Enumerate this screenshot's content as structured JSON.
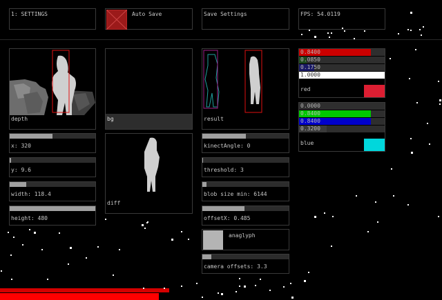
{
  "header": {
    "tab_label": "1: SETTINGS",
    "autosave_label": "Auto Save",
    "save_label": "Save Settings",
    "fps_label": "FPS: 54.0119"
  },
  "views": {
    "depth": "depth",
    "bg": "bg",
    "result": "result",
    "diff": "diff"
  },
  "sliders_left": [
    {
      "label": "x: 320",
      "value": 0.5
    },
    {
      "label": "y: 9.6",
      "value": 0.02
    },
    {
      "label": "width: 118.4",
      "value": 0.19
    },
    {
      "label": "height: 480",
      "value": 1.0
    }
  ],
  "sliders_mid": [
    {
      "label": "kinectAngle: 0",
      "value": 0.5
    },
    {
      "label": "threshold: 3",
      "value": 0.01
    },
    {
      "label": "blob size min: 6144",
      "value": 0.05
    },
    {
      "label": "offsetX: 0.485",
      "value": 0.49
    }
  ],
  "anaglyph": {
    "label": "anaglyph"
  },
  "camera_offsets": {
    "label": "camera offsets: 3.3",
    "value": 0.1
  },
  "red_group": {
    "label": "red",
    "swatch": "#dc1e32",
    "bars": [
      {
        "text": "0.8400",
        "value": 0.84,
        "color": "#cc0000"
      },
      {
        "text": "0.0850",
        "value": 0.085,
        "color": "#1e4a1e"
      },
      {
        "text": "0.1750",
        "value": 0.175,
        "color": "#1a1a66"
      },
      {
        "text": "1.0000",
        "value": 1.0,
        "color": "#ffffff"
      }
    ]
  },
  "blue_group": {
    "label": "blue",
    "swatch": "#00d7dc",
    "bars": [
      {
        "text": "0.0000",
        "value": 0.0,
        "color": "#4a4a4a"
      },
      {
        "text": "0.8400",
        "value": 0.84,
        "color": "#00c800"
      },
      {
        "text": "0.8400",
        "value": 0.84,
        "color": "#0000cc"
      },
      {
        "text": "0.3200",
        "value": 0.32,
        "color": "#3a3a3a"
      }
    ]
  },
  "colors": {
    "background": "#000000",
    "panel_border": "#3a3a3a",
    "accent_red": "#ff0000"
  }
}
